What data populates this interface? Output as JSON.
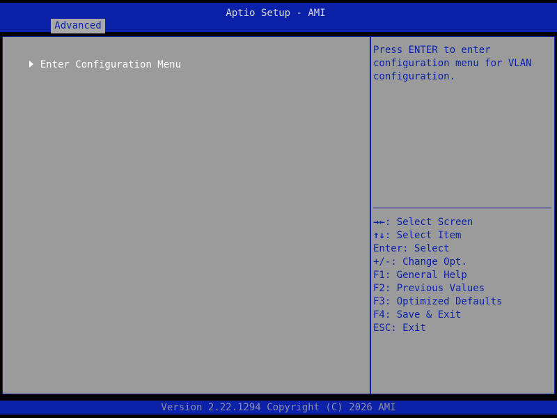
{
  "header": {
    "title": "Aptio Setup - AMI",
    "active_tab": "Advanced"
  },
  "menu": {
    "items": [
      {
        "label": "Enter Configuration Menu",
        "icon": "submenu-arrow-icon"
      }
    ]
  },
  "help": {
    "lines": [
      "Press ENTER to enter",
      "configuration menu for VLAN",
      "configuration."
    ]
  },
  "keys": [
    {
      "key": "→←",
      "desc": ": Select Screen"
    },
    {
      "key": "↑↓",
      "desc": ": Select Item"
    },
    {
      "key": "Enter",
      "desc": ": Select"
    },
    {
      "key": "+/-",
      "desc": ": Change Opt."
    },
    {
      "key": "F1",
      "desc": ": General Help"
    },
    {
      "key": "F2",
      "desc": ": Previous Values"
    },
    {
      "key": "F3",
      "desc": ": Optimized Defaults"
    },
    {
      "key": "F4",
      "desc": ": Save & Exit"
    },
    {
      "key": "ESC",
      "desc": ": Exit"
    }
  ],
  "footer": {
    "text": "Version 2.22.1294 Copyright (C) 2026 AMI"
  },
  "colors": {
    "bios_blue": "#0b22a8",
    "panel_gray": "#9b9b9b",
    "tab_gray": "#a9a9a9",
    "highlight_text": "#ffffff"
  }
}
